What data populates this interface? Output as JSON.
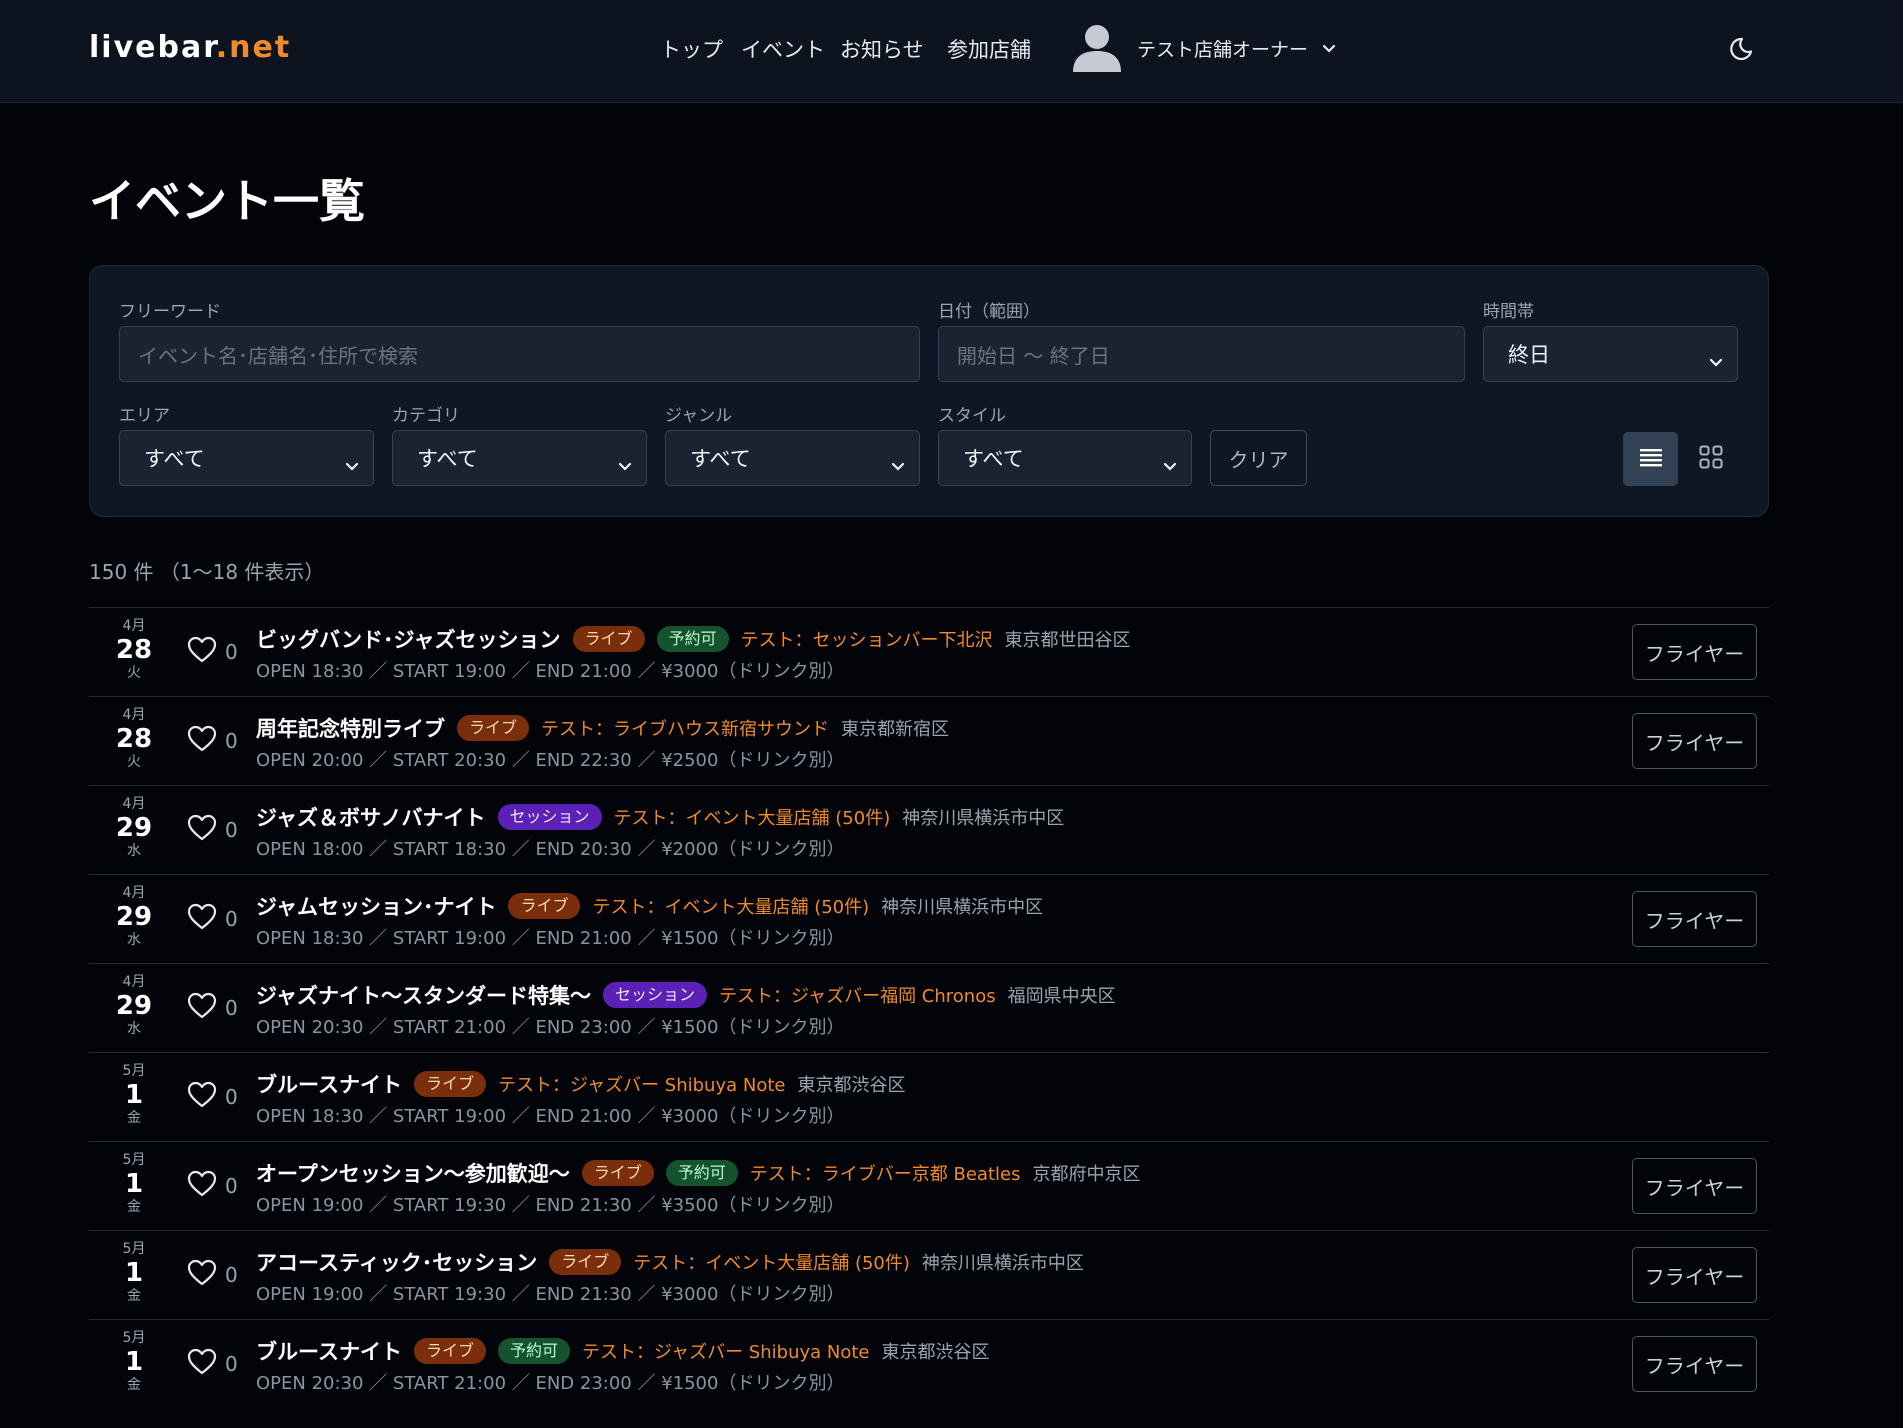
{
  "header": {
    "logo_main": "livebar",
    "logo_accent": ".net",
    "nav": [
      {
        "label": "トップ"
      },
      {
        "label": "イベント"
      },
      {
        "label": "お知らせ"
      },
      {
        "label": "参加店舗"
      }
    ],
    "user_name": "テスト店舗オーナー"
  },
  "page": {
    "title": "イベント一覧",
    "count_text": "150 件 （1〜18 件表示）"
  },
  "filters": {
    "keyword_label": "フリーワード",
    "keyword_placeholder": "イベント名･店舗名･住所で検索",
    "date_label": "日付（範囲）",
    "date_placeholder": "開始日 〜 終了日",
    "time_label": "時間帯",
    "time_value": "終日",
    "area_label": "エリア",
    "area_value": "すべて",
    "category_label": "カテゴリ",
    "category_value": "すべて",
    "genre_label": "ジャンル",
    "genre_value": "すべて",
    "style_label": "スタイル",
    "style_value": "すべて",
    "clear_label": "クリア"
  },
  "colors": {
    "accent": "#f08a2c",
    "live_tag": "#7a2e0b",
    "session_tag": "#5b21b6",
    "reserve_tag": "#14532d"
  },
  "flyer_label": "フライヤー",
  "events": [
    {
      "month": "4月",
      "day": "28",
      "weekday": "火",
      "likes": "0",
      "title": "ビッグバンド･ジャズセッション",
      "tags": [
        {
          "text": "ライブ",
          "kind": "live"
        },
        {
          "text": "予約可",
          "kind": "reserve"
        }
      ],
      "venue": "テスト：セッションバー下北沢",
      "address": "東京都世田谷区",
      "details": "OPEN 18:30 ／ START 19:00 ／ END 21:00 ／ ¥3000（ドリンク別）",
      "flyer": true
    },
    {
      "month": "4月",
      "day": "28",
      "weekday": "火",
      "likes": "0",
      "title": "周年記念特別ライブ",
      "tags": [
        {
          "text": "ライブ",
          "kind": "live"
        }
      ],
      "venue": "テスト：ライブハウス新宿サウンド",
      "address": "東京都新宿区",
      "details": "OPEN 20:00 ／ START 20:30 ／ END 22:30 ／ ¥2500（ドリンク別）",
      "flyer": true
    },
    {
      "month": "4月",
      "day": "29",
      "weekday": "水",
      "likes": "0",
      "title": "ジャズ＆ボサノバナイト",
      "tags": [
        {
          "text": "セッション",
          "kind": "session"
        }
      ],
      "venue": "テスト：イベント大量店舗 (50件)",
      "address": "神奈川県横浜市中区",
      "details": "OPEN 18:00 ／ START 18:30 ／ END 20:30 ／ ¥2000（ドリンク別）",
      "flyer": false
    },
    {
      "month": "4月",
      "day": "29",
      "weekday": "水",
      "likes": "0",
      "title": "ジャムセッション･ナイト",
      "tags": [
        {
          "text": "ライブ",
          "kind": "live"
        }
      ],
      "venue": "テスト：イベント大量店舗 (50件)",
      "address": "神奈川県横浜市中区",
      "details": "OPEN 18:30 ／ START 19:00 ／ END 21:00 ／ ¥1500（ドリンク別）",
      "flyer": true
    },
    {
      "month": "4月",
      "day": "29",
      "weekday": "水",
      "likes": "0",
      "title": "ジャズナイト〜スタンダード特集〜",
      "tags": [
        {
          "text": "セッション",
          "kind": "session"
        }
      ],
      "venue": "テスト：ジャズバー福岡 Chronos",
      "address": "福岡県中央区",
      "details": "OPEN 20:30 ／ START 21:00 ／ END 23:00 ／ ¥1500（ドリンク別）",
      "flyer": false
    },
    {
      "month": "5月",
      "day": "1",
      "weekday": "金",
      "likes": "0",
      "title": "ブルースナイト",
      "tags": [
        {
          "text": "ライブ",
          "kind": "live"
        }
      ],
      "venue": "テスト：ジャズバー Shibuya Note",
      "address": "東京都渋谷区",
      "details": "OPEN 18:30 ／ START 19:00 ／ END 21:00 ／ ¥3000（ドリンク別）",
      "flyer": false
    },
    {
      "month": "5月",
      "day": "1",
      "weekday": "金",
      "likes": "0",
      "title": "オープンセッション〜参加歓迎〜",
      "tags": [
        {
          "text": "ライブ",
          "kind": "live"
        },
        {
          "text": "予約可",
          "kind": "reserve"
        }
      ],
      "venue": "テスト：ライブバー京都 Beatles",
      "address": "京都府中京区",
      "details": "OPEN 19:00 ／ START 19:30 ／ END 21:30 ／ ¥3500（ドリンク別）",
      "flyer": true
    },
    {
      "month": "5月",
      "day": "1",
      "weekday": "金",
      "likes": "0",
      "title": "アコースティック･セッション",
      "tags": [
        {
          "text": "ライブ",
          "kind": "live"
        }
      ],
      "venue": "テスト：イベント大量店舗 (50件)",
      "address": "神奈川県横浜市中区",
      "details": "OPEN 19:00 ／ START 19:30 ／ END 21:30 ／ ¥3000（ドリンク別）",
      "flyer": true
    },
    {
      "month": "5月",
      "day": "1",
      "weekday": "金",
      "likes": "0",
      "title": "ブルースナイト",
      "tags": [
        {
          "text": "ライブ",
          "kind": "live"
        },
        {
          "text": "予約可",
          "kind": "reserve"
        }
      ],
      "venue": "テスト：ジャズバー Shibuya Note",
      "address": "東京都渋谷区",
      "details": "OPEN 20:30 ／ START 21:00 ／ END 23:00 ／ ¥1500（ドリンク別）",
      "flyer": true
    }
  ]
}
